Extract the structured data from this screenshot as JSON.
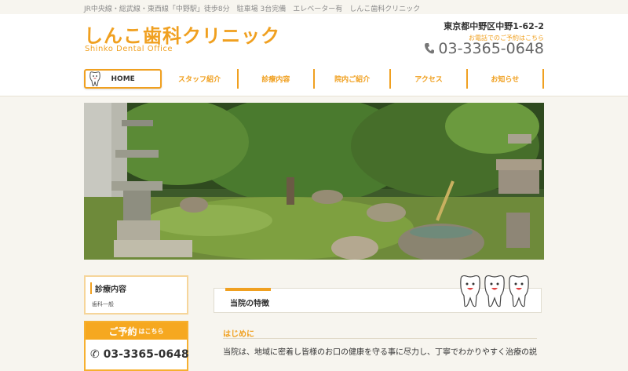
{
  "topbar": {
    "text": "JR中央線・総武線・東西線「中野駅」徒歩8分　駐車場 3台完備　エレベーター有　しんこ歯科クリニック"
  },
  "header": {
    "logo_jp": "しんこ歯科クリニック",
    "logo_en": "Shinko Dental Office",
    "address": "東京都中野区中野1-62-2",
    "tel_note": "お電話でのご予約はこちら",
    "tel": "03-3365-0648"
  },
  "nav": {
    "items": [
      {
        "label": "HOME"
      },
      {
        "label": "スタッフ紹介"
      },
      {
        "label": "診療内容"
      },
      {
        "label": "院内ご紹介"
      },
      {
        "label": "アクセス"
      },
      {
        "label": "お知らせ"
      }
    ]
  },
  "sidebar": {
    "menu_title": "診療内容",
    "menu_item": "歯科一般",
    "reserve_title": "ご予約",
    "reserve_suffix": "はこちら",
    "reserve_tel": "03-3365-0648"
  },
  "main": {
    "feature_title": "当院の特徴",
    "intro_heading": "はじめに",
    "intro_text": "当院は、地域に密着し皆様のお口の健康を守る事に尽力し、丁寧でわかりやすく治療の説明"
  },
  "colors": {
    "accent": "#f0a020",
    "background": "#f7f5ef"
  }
}
